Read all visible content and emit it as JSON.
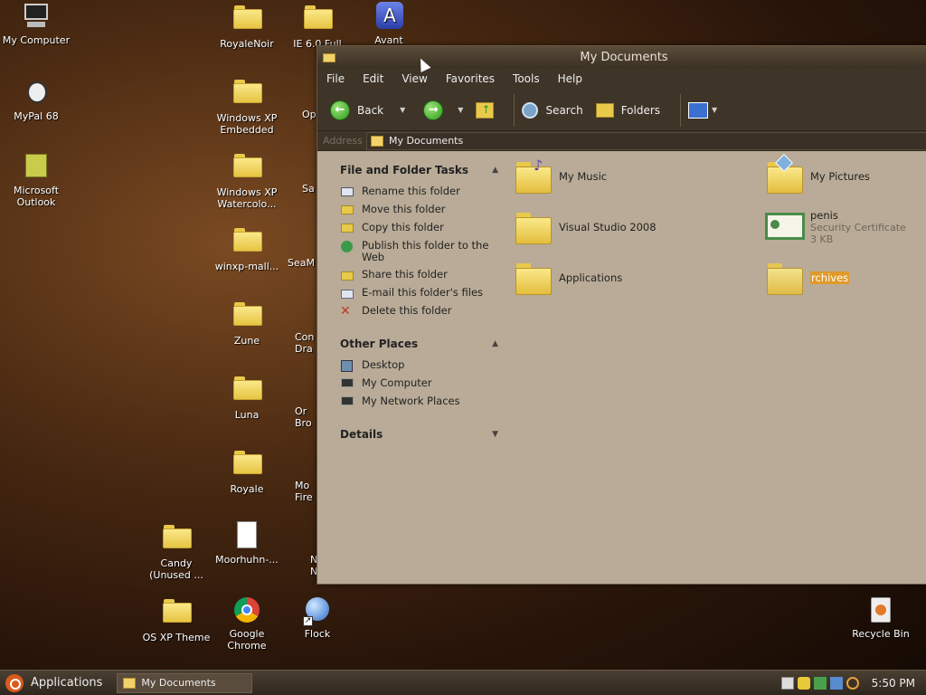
{
  "desktop": {
    "icons": [
      {
        "id": "my-computer",
        "label": "My Computer"
      },
      {
        "id": "mypal",
        "label": "MyPal 68"
      },
      {
        "id": "outlook",
        "label": "Microsoft Outlook"
      },
      {
        "id": "royalenoir",
        "label": "RoyaleNoir"
      },
      {
        "id": "ie6",
        "label": "IE 6.0 Full"
      },
      {
        "id": "avant",
        "label": "Avant"
      },
      {
        "id": "xp-embedded",
        "label": "Windows XP Embedded"
      },
      {
        "id": "opera",
        "label": "Op"
      },
      {
        "id": "xp-watercolor",
        "label": "Windows XP Watercolo..."
      },
      {
        "id": "sa",
        "label": "Sa"
      },
      {
        "id": "winxp-mall",
        "label": "winxp-mall..."
      },
      {
        "id": "seam",
        "label": "SeaM"
      },
      {
        "id": "zune",
        "label": "Zune"
      },
      {
        "id": "con",
        "label": "Con Dra"
      },
      {
        "id": "luna",
        "label": "Luna"
      },
      {
        "id": "ora",
        "label": "Or Bro"
      },
      {
        "id": "royale",
        "label": "Royale"
      },
      {
        "id": "mo",
        "label": "Mo Fire"
      },
      {
        "id": "candy",
        "label": "Candy (Unused ..."
      },
      {
        "id": "moorhuhn",
        "label": "Moorhuhn-..."
      },
      {
        "id": "nets",
        "label": "Nets Navi"
      },
      {
        "id": "osxp",
        "label": "OS XP Theme"
      },
      {
        "id": "chrome",
        "label": "Google Chrome"
      },
      {
        "id": "flock",
        "label": "Flock"
      },
      {
        "id": "recycle",
        "label": "Recycle Bin"
      }
    ]
  },
  "window": {
    "title": "My Documents",
    "menu": [
      "File",
      "Edit",
      "View",
      "Favorites",
      "Tools",
      "Help"
    ],
    "toolbar": {
      "back": "Back",
      "search": "Search",
      "folders": "Folders"
    },
    "address": {
      "label": "Address",
      "value": "My Documents"
    },
    "tasks": {
      "title": "File and Folder Tasks",
      "items": [
        "Rename this folder",
        "Move this folder",
        "Copy this folder",
        "Publish this folder to the Web",
        "Share this folder",
        "E-mail this folder's files",
        "Delete this folder"
      ]
    },
    "other_places": {
      "title": "Other Places",
      "items": [
        "Desktop",
        "My Computer",
        "My Network Places"
      ]
    },
    "details": {
      "title": "Details"
    },
    "files": [
      {
        "name": "My Music"
      },
      {
        "name": "My Pictures"
      },
      {
        "name": "Visual Studio 2008"
      },
      {
        "name": "penis",
        "type": "Security Certificate",
        "size": "3 KB"
      },
      {
        "name": "Applications"
      },
      {
        "name": "rchives"
      }
    ]
  },
  "taskbar": {
    "applications": "Applications",
    "task": "My Documents",
    "clock": "5:50 PM"
  }
}
